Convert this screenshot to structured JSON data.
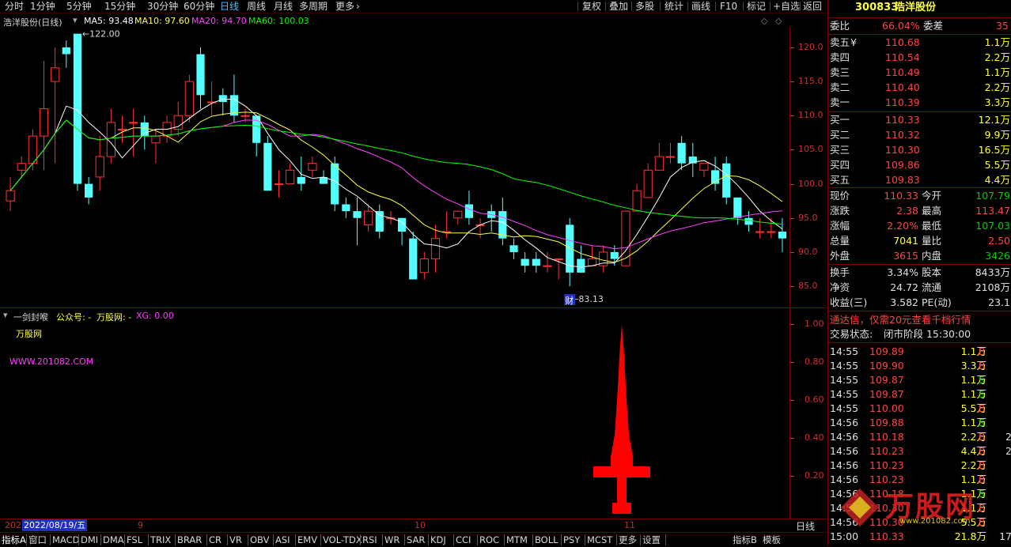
{
  "toolbar": {
    "periods": [
      "分时",
      "1分钟",
      "5分钟",
      "15分钟",
      "30分钟",
      "60分钟",
      "日线",
      "周线",
      "月线",
      "多周期",
      "更多"
    ],
    "active_period": "日线",
    "right_buttons": [
      "复权",
      "叠加",
      "多股",
      "统计",
      "画线",
      "F10",
      "标记",
      "+自选",
      "返回"
    ]
  },
  "main_header": {
    "title": "浩洋股份(日线)",
    "ma5": "MA5: 93.48",
    "ma10": "MA10: 97.60",
    "ma20": "MA20: 94.70",
    "ma60": "MA60: 100.03"
  },
  "price_axis": [
    "120.0",
    "115.0",
    "110.0",
    "105.0",
    "100.0",
    "95.0",
    "90.0",
    "85.0"
  ],
  "annotations": {
    "high": "122.00",
    "low": "83.13",
    "low_marker": "财"
  },
  "indicator_header": {
    "name": "一剑封喉",
    "public": "公众号: -",
    "site": "万股网: -",
    "xg": "XG: 0.00",
    "watermark1": "万股网",
    "watermark2": "WWW.201082.COM"
  },
  "ind_axis": [
    "1.00",
    "0.80",
    "0.60",
    "0.40",
    "0.20"
  ],
  "date_axis": {
    "start": "202",
    "cursor_date": "2022/08/19/五",
    "months": [
      "9",
      "10",
      "11"
    ],
    "period_label": "日线"
  },
  "bottom_tabs": [
    "指标A",
    "窗口",
    "MACD",
    "DMI",
    "DMA",
    "FSL",
    "TRIX",
    "BRAR",
    "CR",
    "VR",
    "OBV",
    "ASI",
    "EMV",
    "VOL-TDX",
    "RSI",
    "WR",
    "SAR",
    "KDJ",
    "CCI",
    "ROC",
    "MTM",
    "BOLL",
    "PSY",
    "MCST",
    "更多",
    "设置"
  ],
  "bottom_right_tabs": [
    "指标B",
    "模板"
  ],
  "stock": {
    "code": "300833",
    "name": "浩洋股份"
  },
  "order_book": {
    "weibi_label": "委比",
    "weibi": "66.04%",
    "weicha_label": "委差",
    "weicha": "35",
    "sells": [
      {
        "label": "卖五",
        "mark": "¥",
        "price": "110.68",
        "vol": "1.1万"
      },
      {
        "label": "卖四",
        "mark": "",
        "price": "110.54",
        "vol": "2.2万"
      },
      {
        "label": "卖三",
        "mark": "",
        "price": "110.49",
        "vol": "1.1万"
      },
      {
        "label": "卖二",
        "mark": "",
        "price": "110.40",
        "vol": "2.2万"
      },
      {
        "label": "卖一",
        "mark": "",
        "price": "110.39",
        "vol": "3.3万"
      }
    ],
    "buys": [
      {
        "label": "买一",
        "price": "110.33",
        "vol": "12.1万"
      },
      {
        "label": "买二",
        "price": "110.32",
        "vol": "9.9万"
      },
      {
        "label": "买三",
        "price": "110.30",
        "vol": "16.5万"
      },
      {
        "label": "买四",
        "price": "109.86",
        "vol": "5.5万"
      },
      {
        "label": "买五",
        "price": "109.83",
        "vol": "4.4万"
      }
    ]
  },
  "quote": [
    {
      "l1": "现价",
      "v1": "110.33",
      "c1": "red",
      "l2": "今开",
      "v2": "107.79",
      "c2": "grn"
    },
    {
      "l1": "涨跌",
      "v1": "2.38",
      "c1": "red",
      "l2": "最高",
      "v2": "113.47",
      "c2": "red"
    },
    {
      "l1": "涨幅",
      "v1": "2.20%",
      "c1": "red",
      "l2": "最低",
      "v2": "107.03",
      "c2": "grn"
    },
    {
      "l1": "总量",
      "v1": "7041",
      "c1": "yel",
      "l2": "量比",
      "v2": "2.50",
      "c2": "red"
    },
    {
      "l1": "外盘",
      "v1": "3615",
      "c1": "red",
      "l2": "内盘",
      "v2": "3426",
      "c2": "grn"
    }
  ],
  "fundamentals": [
    {
      "l1": "换手",
      "v1": "3.34%",
      "l2": "股本",
      "v2": "8433万"
    },
    {
      "l1": "净资",
      "v1": "24.72",
      "l2": "流通",
      "v2": "2108万"
    },
    {
      "l1": "收益(三)",
      "v1": "3.582",
      "l2": "PE(动)",
      "v2": "23.1"
    }
  ],
  "ad_text": "通达信，仅需20元查看千档行情",
  "trade_status_label": "交易状态:",
  "trade_status": "闭市阶段 15:30:00",
  "ticks": [
    {
      "t": "14:55",
      "p": "109.89",
      "v": "1.1万",
      "s": "B",
      "n": ""
    },
    {
      "t": "14:55",
      "p": "109.90",
      "v": "3.3万",
      "s": "B",
      "n": ""
    },
    {
      "t": "14:55",
      "p": "109.87",
      "v": "1.1万",
      "s": "S",
      "n": ""
    },
    {
      "t": "14:55",
      "p": "109.87",
      "v": "1.1万",
      "s": "S",
      "n": ""
    },
    {
      "t": "14:55",
      "p": "110.00",
      "v": "5.5万",
      "s": "B",
      "n": ""
    },
    {
      "t": "14:56",
      "p": "109.88",
      "v": "1.1万",
      "s": "S",
      "n": ""
    },
    {
      "t": "14:56",
      "p": "110.18",
      "v": "2.2万",
      "s": "B",
      "n": "2"
    },
    {
      "t": "14:56",
      "p": "110.23",
      "v": "4.4万",
      "s": "B",
      "n": "2"
    },
    {
      "t": "14:56",
      "p": "110.23",
      "v": "2.2万",
      "s": "B",
      "n": ""
    },
    {
      "t": "14:56",
      "p": "110.23",
      "v": "1.1万",
      "s": "B",
      "n": ""
    },
    {
      "t": "14:56",
      "p": "110.18",
      "v": "1.1万",
      "s": "S",
      "n": ""
    },
    {
      "t": "14:56",
      "p": "110.30",
      "v": "1.1万",
      "s": "B",
      "n": ""
    },
    {
      "t": "14:56",
      "p": "110.30",
      "v": "5.5万",
      "s": "B",
      "n": ""
    },
    {
      "t": "15:00",
      "p": "110.33",
      "v": "21.8万",
      "s": "",
      "n": "17"
    }
  ],
  "logo_text": "万股网",
  "logo_url": "www.201082.com",
  "chart_data": {
    "type": "candlestick",
    "ylim": [
      82,
      123
    ],
    "candles": [
      [
        97.5,
        99,
        96,
        101
      ],
      [
        102,
        103,
        101,
        104
      ],
      [
        103,
        107,
        102,
        108
      ],
      [
        107,
        111,
        102,
        118
      ],
      [
        115,
        117,
        103,
        120
      ],
      [
        120,
        119,
        117,
        121
      ],
      [
        122,
        100,
        99,
        122
      ],
      [
        100,
        98,
        97,
        101
      ],
      [
        101,
        104,
        99,
        107
      ],
      [
        104,
        109,
        103,
        111
      ],
      [
        108,
        108,
        106,
        110
      ],
      [
        109,
        109,
        104,
        111
      ],
      [
        109,
        107,
        105,
        110
      ],
      [
        106,
        107,
        103,
        108
      ],
      [
        107,
        109,
        106,
        110
      ],
      [
        108,
        110,
        107,
        112
      ],
      [
        110,
        115,
        109,
        116
      ],
      [
        119,
        113,
        111,
        120
      ],
      [
        112,
        112,
        110,
        115
      ],
      [
        113,
        112,
        110,
        114
      ],
      [
        113,
        110,
        109,
        116
      ],
      [
        110,
        110,
        109,
        111
      ],
      [
        110,
        106,
        104,
        110
      ],
      [
        106,
        99,
        99,
        107
      ],
      [
        100,
        100,
        98,
        102
      ],
      [
        100,
        102,
        100,
        103
      ],
      [
        101,
        100,
        99,
        104
      ],
      [
        102,
        103,
        101,
        104
      ],
      [
        101,
        100,
        100,
        102
      ],
      [
        103,
        97,
        96,
        104
      ],
      [
        97,
        96,
        95,
        98
      ],
      [
        96,
        95,
        91,
        98
      ],
      [
        94,
        96,
        93,
        97
      ],
      [
        96,
        93,
        92,
        97
      ],
      [
        95,
        95,
        94,
        96
      ],
      [
        95,
        93,
        91,
        95
      ],
      [
        92,
        86,
        86,
        93
      ],
      [
        87,
        89,
        86,
        90
      ],
      [
        89,
        92,
        87,
        94
      ],
      [
        93,
        93,
        92,
        96
      ],
      [
        95,
        96,
        94,
        96
      ],
      [
        97,
        95,
        94,
        99
      ],
      [
        94,
        94,
        92,
        95
      ],
      [
        96,
        95,
        93,
        97
      ],
      [
        96,
        92,
        91,
        98
      ],
      [
        91,
        90,
        89,
        92
      ],
      [
        89,
        88,
        87,
        90
      ],
      [
        89,
        88,
        87,
        90
      ],
      [
        88,
        88,
        87,
        90
      ],
      [
        89,
        89,
        86,
        89
      ],
      [
        94,
        87,
        85,
        95
      ],
      [
        89,
        87,
        87,
        91
      ],
      [
        88,
        89,
        88,
        91
      ],
      [
        88,
        90,
        87,
        91
      ],
      [
        90,
        89,
        88,
        91
      ],
      [
        88,
        96,
        88,
        96
      ],
      [
        96,
        99,
        96,
        100
      ],
      [
        98,
        102,
        98,
        103
      ],
      [
        102,
        104,
        102,
        106
      ],
      [
        104,
        104,
        103,
        106
      ],
      [
        106,
        103,
        102,
        107
      ],
      [
        104,
        103,
        101,
        106
      ],
      [
        102,
        103,
        101,
        103
      ],
      [
        102,
        100,
        99,
        104
      ],
      [
        103,
        98,
        97,
        104
      ],
      [
        98,
        95,
        94,
        98
      ],
      [
        95,
        94,
        93,
        96
      ],
      [
        93,
        93,
        92,
        95
      ],
      [
        93,
        93,
        92,
        95
      ],
      [
        93,
        92,
        90,
        95
      ]
    ],
    "ma_colors": {
      "ma5": "#ffffff",
      "ma10": "#ffff40",
      "ma20": "#ff40ff",
      "ma60": "#00ff00"
    },
    "indicator_series": {
      "name": "XG",
      "values": [
        0,
        0,
        0,
        0,
        0,
        0,
        0,
        0,
        0,
        0,
        0,
        0,
        0,
        0,
        0,
        0,
        0,
        0,
        0,
        0,
        0,
        0,
        0,
        0,
        0,
        0,
        0,
        0,
        0,
        0,
        0,
        0,
        0,
        0,
        0,
        0,
        0,
        0,
        0,
        0,
        0,
        0,
        0,
        0,
        0,
        0,
        0,
        0,
        0,
        0,
        0,
        0,
        0,
        0,
        0,
        0,
        0,
        0,
        0,
        0,
        0,
        0,
        0,
        0,
        0,
        0,
        0,
        0,
        0,
        0
      ]
    }
  }
}
